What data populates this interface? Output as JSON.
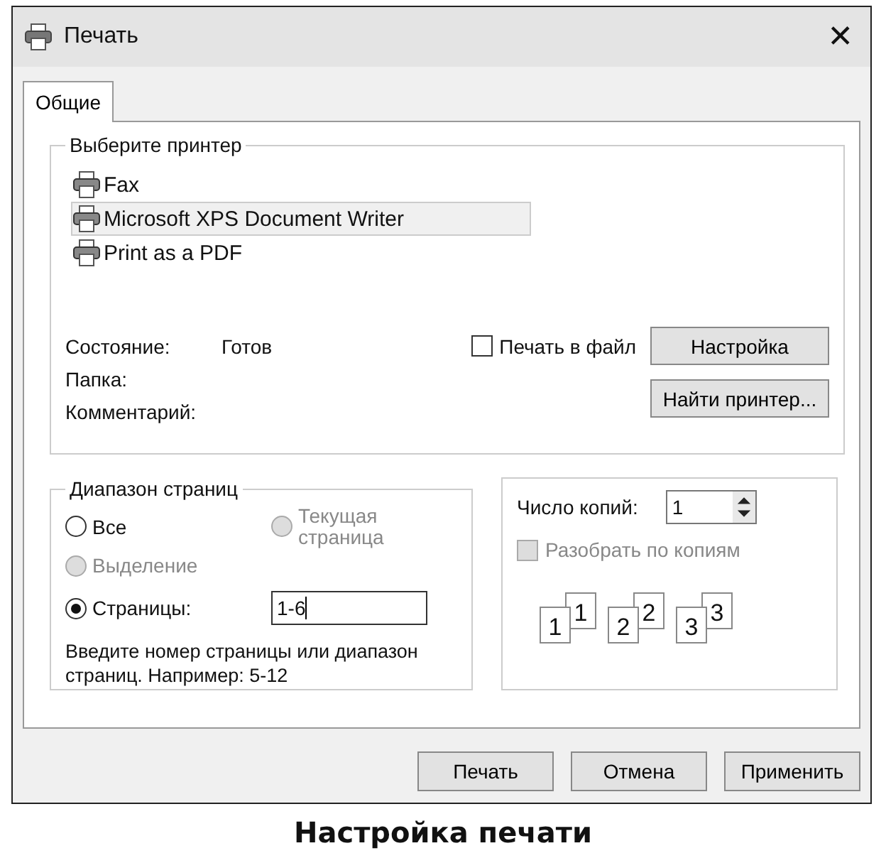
{
  "window": {
    "title": "Печать",
    "close": "✕"
  },
  "tabs": [
    {
      "label": "Общие",
      "selected": true
    }
  ],
  "printer_group": {
    "title": "Выберите принтер",
    "printers": [
      {
        "name": "Fax",
        "selected": false
      },
      {
        "name": "Microsoft XPS Document Writer",
        "selected": true
      },
      {
        "name": "Print as a PDF",
        "selected": false
      }
    ],
    "status_label": "Состояние:",
    "status_value": "Готов",
    "folder_label": "Папка:",
    "comment_label": "Комментарий:",
    "print_to_file": {
      "label": "Печать в файл",
      "checked": false
    },
    "preferences_button": "Настройка",
    "find_button": "Найти принтер..."
  },
  "page_range": {
    "title": "Диапазон страниц",
    "options": [
      {
        "label": "Все",
        "selected": false,
        "disabled": false
      },
      {
        "label": "Текущая страница",
        "selected": false,
        "disabled": true
      },
      {
        "label": "Выделение",
        "selected": false,
        "disabled": true
      },
      {
        "label": "Страницы:",
        "selected": true,
        "disabled": false
      }
    ],
    "pages_value": "1-6",
    "hint": "Введите номер страницы или диапазон страниц.  Например: 5-12"
  },
  "copies": {
    "label": "Число копий:",
    "value": "1",
    "collate": {
      "label": "Разобрать по копиям",
      "checked": false,
      "disabled": true
    },
    "collate_pages": [
      {
        "back": "1",
        "front": "1"
      },
      {
        "back": "2",
        "front": "2"
      },
      {
        "back": "3",
        "front": "3"
      }
    ]
  },
  "buttons": [
    "Печать",
    "Отмена",
    "Применить"
  ],
  "caption": "Настройка печати"
}
